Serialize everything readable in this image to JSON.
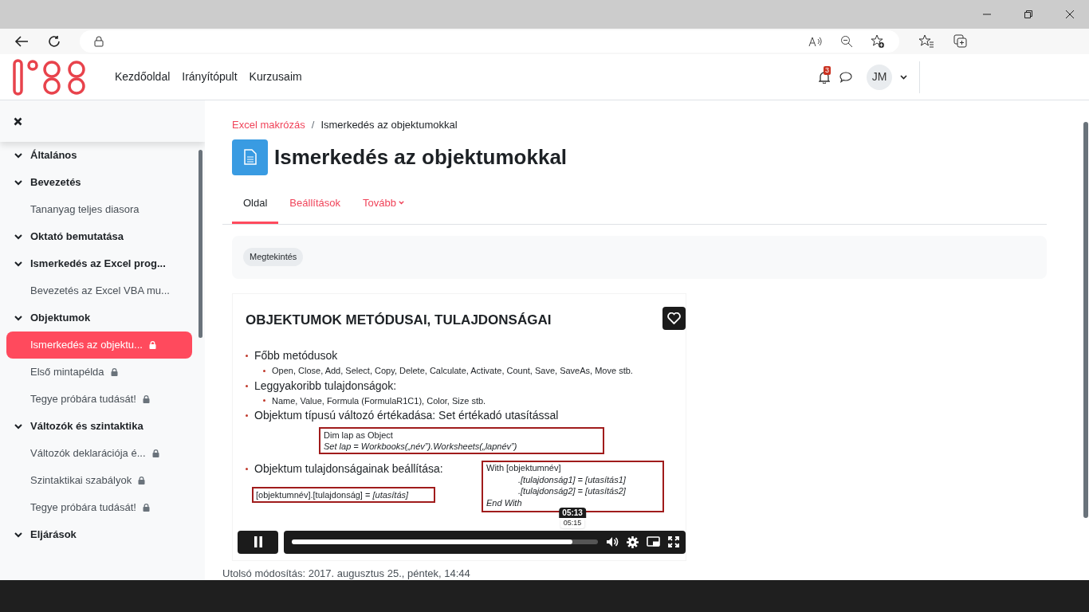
{
  "site_nav": {
    "links": [
      {
        "label": "Kezdőoldal"
      },
      {
        "label": "Irányítópult"
      },
      {
        "label": "Kurzusaim"
      }
    ],
    "notification_count": "3",
    "user_initials": "JM"
  },
  "sidebar": {
    "sections": [
      {
        "title": "Általános",
        "expanded": true
      },
      {
        "title": "Bevezetés",
        "expanded": true,
        "items": [
          {
            "label": "Tananyag teljes diasora",
            "locked": false,
            "selected": false
          }
        ]
      },
      {
        "title": "Oktató bemutatása",
        "expanded": true
      },
      {
        "title": "Ismerkedés az Excel prog...",
        "expanded": true,
        "items": [
          {
            "label": "Bevezetés az Excel VBA mu...",
            "locked": false,
            "selected": false
          }
        ]
      },
      {
        "title": "Objektumok",
        "expanded": true,
        "items": [
          {
            "label": "Ismerkedés az objektu...",
            "locked": true,
            "selected": true
          },
          {
            "label": "Első mintapélda",
            "locked": true,
            "selected": false
          },
          {
            "label": "Tegye próbára tudását!",
            "locked": true,
            "selected": false
          }
        ]
      },
      {
        "title": "Változók és szintaktika",
        "expanded": true,
        "items": [
          {
            "label": "Változók deklarációja é...",
            "locked": true,
            "selected": false
          },
          {
            "label": "Szintaktikai szabályok",
            "locked": true,
            "selected": false
          },
          {
            "label": "Tegye próbára tudását!",
            "locked": true,
            "selected": false
          }
        ]
      },
      {
        "title": "Eljárások",
        "expanded": true
      }
    ]
  },
  "breadcrumb": {
    "separator": "/",
    "items": [
      {
        "label": "Excel makrózás",
        "link": true
      },
      {
        "label": "Ismerkedés az objektumokkal",
        "link": false
      }
    ]
  },
  "page_title": "Ismerkedés az objektumokkal",
  "tabs": [
    {
      "label": "Oldal",
      "selected": true,
      "dropdown": false
    },
    {
      "label": "Beállítások",
      "selected": false,
      "dropdown": false
    },
    {
      "label": "Tovább",
      "selected": false,
      "dropdown": true
    }
  ],
  "action_button": "Megtekintés",
  "slide": {
    "title": "OBJEKTUMOK METÓDUSAI, TULAJDONSÁGAI",
    "bullets": [
      {
        "text": "Főbb metódusok",
        "children": [
          "Open, Close, Add, Select, Copy, Delete, Calculate, Activate, Count, Save, SaveAs, Move stb."
        ]
      },
      {
        "text": "Leggyakoribb tulajdonságok:",
        "children": [
          "Name, Value, Formula (FormulaR1C1), Color, Size stb."
        ]
      },
      {
        "text": "Objektum típusú változó értékadása: Set értékadó utasítással"
      }
    ],
    "code_box_1": [
      {
        "text": "Dim lap as Object",
        "italic": false
      },
      {
        "text": "Set  lap = Workbooks(„név”).Worksheets(„lapnév”)",
        "italic": true
      }
    ],
    "bullet_4": "Objektum tulajdonságainak beállítása:",
    "code_box_2": "[objektumnév].[tulajdonság] = *[utasítás]*",
    "code_box_3": [
      {
        "text": "With  [objektumnév]",
        "italic": false,
        "indent": false
      },
      {
        "text": ".[tulajdonság1] = [utasítás1]",
        "italic": true,
        "indent": true
      },
      {
        "text": ".[tulajdonság2] = [utasítás2]",
        "italic": true,
        "indent": true
      },
      {
        "text": "End With",
        "italic": true,
        "indent": false
      }
    ]
  },
  "player": {
    "playing": true,
    "level": 0.917,
    "current_time": "05:13",
    "hover_time": "05:15"
  },
  "last_modified": "Utolsó módosítás: 2017. augusztus 25., péntek, 14:44"
}
